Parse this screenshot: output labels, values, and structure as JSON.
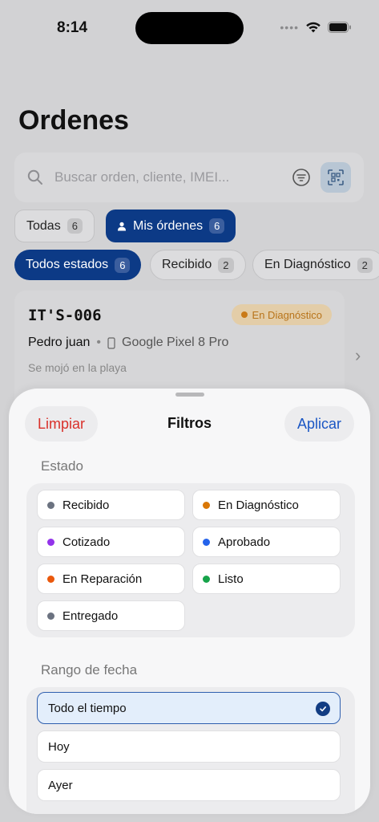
{
  "status_bar": {
    "time": "8:14"
  },
  "page": {
    "title": "Ordenes"
  },
  "search": {
    "placeholder": "Buscar orden, cliente, IMEI..."
  },
  "scope_tabs": [
    {
      "label": "Todas",
      "count": "6"
    },
    {
      "label": "Mis órdenes",
      "count": "6"
    }
  ],
  "status_chips": [
    {
      "label": "Todos estados",
      "count": "6"
    },
    {
      "label": "Recibido",
      "count": "2"
    },
    {
      "label": "En Diagnóstico",
      "count": "2"
    }
  ],
  "order_card": {
    "id": "IT'S-006",
    "status": "En Diagnóstico",
    "customer": "Pedro juan",
    "device": "Google Pixel 8 Pro",
    "note": "Se mojó en la playa"
  },
  "sheet": {
    "title": "Filtros",
    "clear_label": "Limpiar",
    "apply_label": "Aplicar",
    "status_section": "Estado",
    "statuses": [
      {
        "label": "Recibido",
        "color": "#6b7280"
      },
      {
        "label": "En Diagnóstico",
        "color": "#d97706"
      },
      {
        "label": "Cotizado",
        "color": "#9333ea"
      },
      {
        "label": "Aprobado",
        "color": "#2563eb"
      },
      {
        "label": "En Reparación",
        "color": "#ea580c"
      },
      {
        "label": "Listo",
        "color": "#16a34a"
      },
      {
        "label": "Entregado",
        "color": "#6b7280"
      }
    ],
    "date_section": "Rango de fecha",
    "date_ranges": [
      {
        "label": "Todo el tiempo",
        "selected": true
      },
      {
        "label": "Hoy",
        "selected": false
      },
      {
        "label": "Ayer",
        "selected": false
      }
    ]
  }
}
